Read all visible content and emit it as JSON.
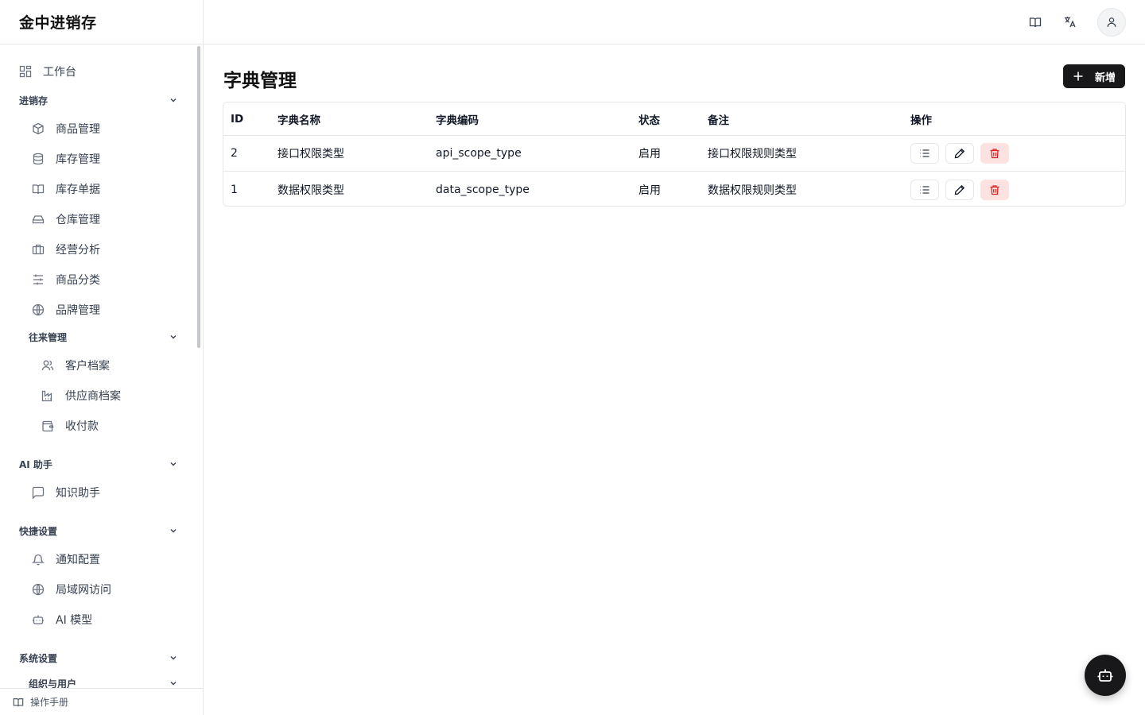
{
  "app": {
    "brand": "金中进销存"
  },
  "sidebar": {
    "workbench": "工作台",
    "groups": {
      "inventory": "进销存",
      "contacts": "往来管理",
      "ai": "AI 助手",
      "shortcuts": "快捷设置",
      "system": "系统设置",
      "org": "组织与用户"
    },
    "inventory_items": [
      "商品管理",
      "库存管理",
      "库存单据",
      "仓库管理",
      "经营分析",
      "商品分类",
      "品牌管理"
    ],
    "contacts_items": [
      "客户档案",
      "供应商档案",
      "收付款"
    ],
    "ai_items": [
      "知识助手"
    ],
    "shortcut_items": [
      "通知配置",
      "局域网访问",
      "AI 模型"
    ],
    "footer": "操作手册"
  },
  "header": {
    "icons": [
      "book-icon",
      "translate-icon",
      "user-icon"
    ]
  },
  "main": {
    "title": "字典管理",
    "add_label": "新增",
    "table": {
      "columns": [
        "ID",
        "字典名称",
        "字典编码",
        "状态",
        "备注",
        "操作"
      ],
      "rows": [
        {
          "id": "2",
          "name": "接口权限类型",
          "code": "api_scope_type",
          "status": "启用",
          "note": "接口权限规则类型"
        },
        {
          "id": "1",
          "name": "数据权限类型",
          "code": "data_scope_type",
          "status": "启用",
          "note": "数据权限规则类型"
        }
      ]
    }
  },
  "colors": {
    "primary": "#18181b",
    "danger": "#dc2626",
    "danger_bg": "#fde2e2",
    "border": "#e5e7eb"
  }
}
